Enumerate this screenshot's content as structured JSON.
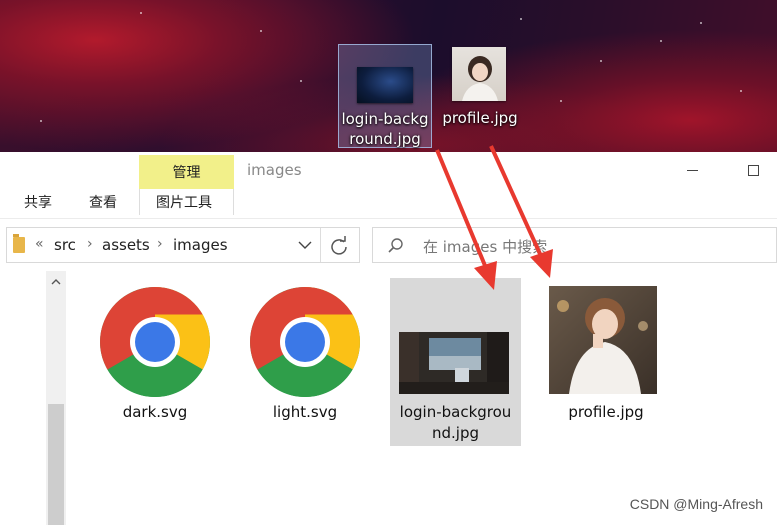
{
  "desktop": {
    "items": [
      {
        "label_line1": "login-backg",
        "label_line2": "round.jpg"
      },
      {
        "label": "profile.jpg"
      }
    ]
  },
  "ribbon": {
    "manage_tab": "管理",
    "window_title": "images",
    "tabs": [
      "共享",
      "查看"
    ],
    "picture_tools": "图片工具"
  },
  "address": {
    "overflow": "«",
    "crumbs": [
      "src",
      "assets",
      "images"
    ]
  },
  "search": {
    "placeholder": "在 images 中搜索"
  },
  "files": [
    {
      "name": "dark.svg",
      "icon": "chrome-icon"
    },
    {
      "name": "light.svg",
      "icon": "chrome-icon"
    },
    {
      "name_line1": "login-backgrou",
      "name_line2": "nd.jpg",
      "icon": "image-thumbnail"
    },
    {
      "name": "profile.jpg",
      "icon": "image-thumbnail"
    }
  ],
  "watermark": "CSDN @Ming-Afresh",
  "colors": {
    "manage_tab_bg": "#f2f08a",
    "arrow": "#e8392f",
    "selection": "#d9d9d9"
  }
}
